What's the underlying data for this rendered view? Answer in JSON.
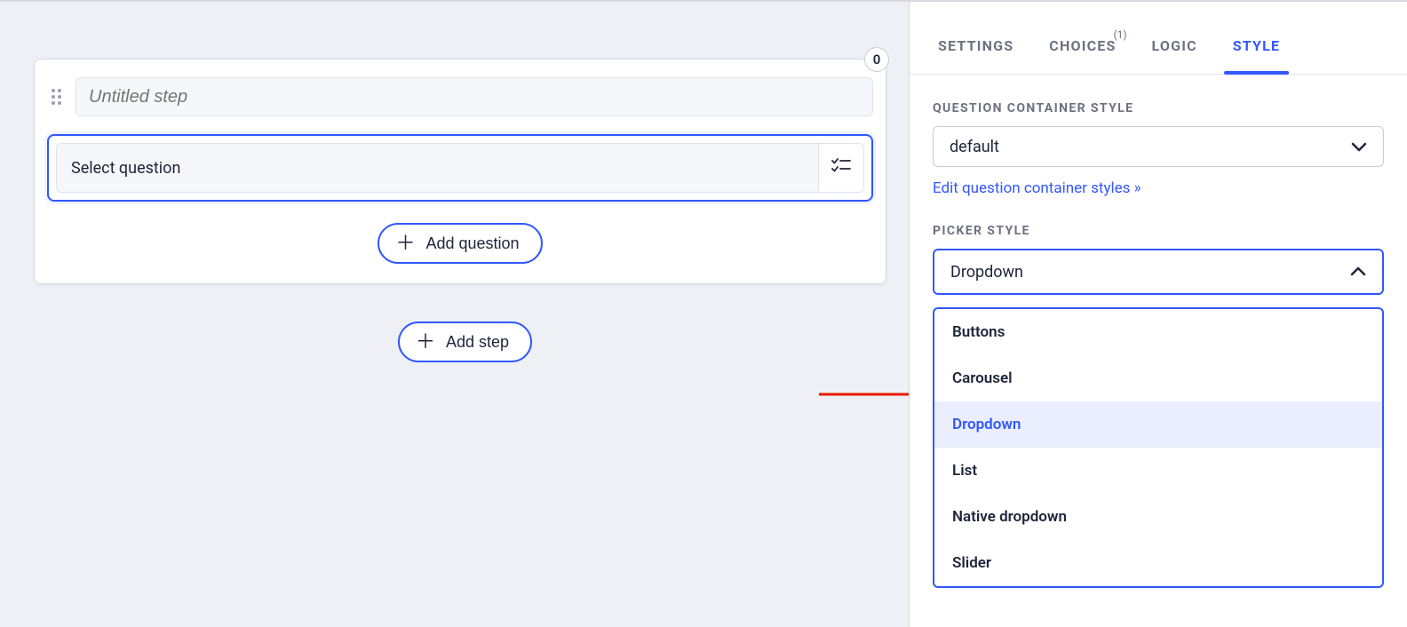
{
  "step_card": {
    "count": "0",
    "title_placeholder": "Untitled step",
    "question_placeholder": "Select question",
    "add_question_label": "Add question",
    "add_step_label": "Add step"
  },
  "sidebar": {
    "tabs": [
      {
        "label": "SETTINGS"
      },
      {
        "label": "CHOICES",
        "badge": "(1)"
      },
      {
        "label": "LOGIC"
      },
      {
        "label": "STYLE"
      }
    ],
    "container_style": {
      "label": "QUESTION CONTAINER STYLE",
      "value": "default",
      "edit_link": "Edit question container styles »"
    },
    "picker_style": {
      "label": "PICKER STYLE",
      "value": "Dropdown",
      "options": [
        "Buttons",
        "Carousel",
        "Dropdown",
        "List",
        "Native dropdown",
        "Slider"
      ]
    }
  }
}
